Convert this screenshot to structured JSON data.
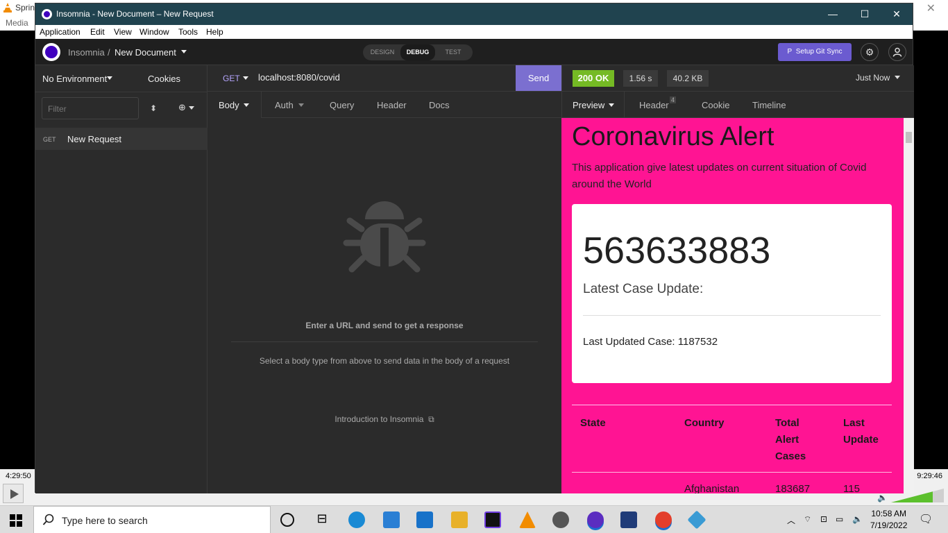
{
  "background_app": {
    "title_fragment": "Sprin",
    "menu_fragment": "Media",
    "close_glyph": "✕",
    "time_left": "4:29:50",
    "time_right": "9:29:46"
  },
  "window": {
    "title": "Insomnia - New Document – New Request",
    "minimize": "—",
    "maximize": "☐",
    "close": "✕"
  },
  "menu": [
    "Application",
    "Edit",
    "View",
    "Window",
    "Tools",
    "Help"
  ],
  "header": {
    "app_name": "Insomnia",
    "separator": "/",
    "document": "New Document",
    "modes": [
      "DESIGN",
      "DEBUG",
      "TEST"
    ],
    "active_mode": "DEBUG",
    "git_sync": "Setup Git Sync",
    "git_icon": "P"
  },
  "sidebar": {
    "environment": "No Environment",
    "cookies": "Cookies",
    "filter_placeholder": "Filter",
    "requests": [
      {
        "method": "GET",
        "name": "New Request"
      }
    ]
  },
  "request": {
    "method": "GET",
    "url": "localhost:8080/covid",
    "send": "Send",
    "tabs": [
      "Body",
      "Auth",
      "Query",
      "Header",
      "Docs"
    ],
    "empty_title": "Enter a URL and send to get a response",
    "empty_sub": "Select a body type from above to send data in the body of a request",
    "intro_link": "Introduction to Insomnia"
  },
  "response": {
    "status": "200 OK",
    "time": "1.56 s",
    "size": "40.2 KB",
    "history": "Just Now",
    "tabs": [
      "Preview",
      "Header",
      "Cookie",
      "Timeline"
    ],
    "header_count": "4"
  },
  "preview": {
    "title": "Coronavirus Alert",
    "subtitle": "This application give latest updates on current situation of Covid around the World",
    "total_cases": "563633883",
    "latest_label": "Latest Case Update:",
    "last_updated": "Last Updated Case: 1187532",
    "columns": [
      "State",
      "Country",
      "Total\nAlert\nCases",
      "Last\nUpdate"
    ],
    "first_row": {
      "state": "",
      "country": "Afghanistan",
      "total": "183687",
      "last": "115"
    }
  },
  "taskbar": {
    "search_placeholder": "Type here to search",
    "time": "10:58 AM",
    "date": "7/19/2022"
  },
  "colors": {
    "accent": "#7b6fd0",
    "status_ok": "#75ba24",
    "preview_bg": "#ff1493",
    "titlebar": "#20434f"
  }
}
